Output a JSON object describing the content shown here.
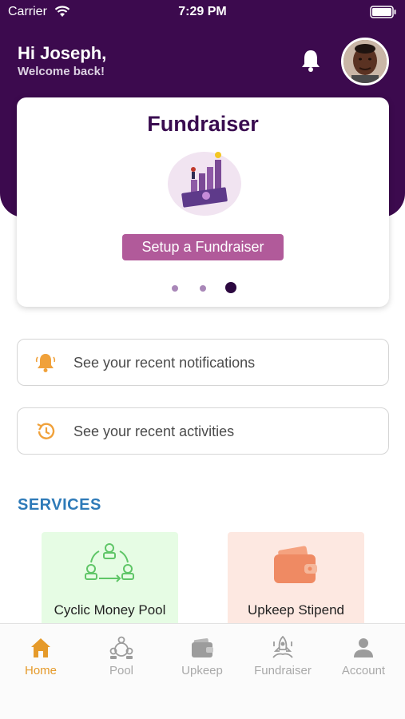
{
  "status_bar": {
    "carrier": "Carrier",
    "time": "7:29 PM"
  },
  "header": {
    "greeting": "Hi Joseph,",
    "subtitle": "Welcome back!"
  },
  "carousel": {
    "title": "Fundraiser",
    "button_label": "Setup a Fundraiser",
    "page_count": 3,
    "active_page": 3
  },
  "quick_links": [
    {
      "label": "See your recent notifications",
      "icon": "bell-icon"
    },
    {
      "label": "See your recent activities",
      "icon": "history-icon"
    }
  ],
  "services": {
    "title": "SERVICES",
    "items": [
      {
        "label": "Cyclic Money Pool",
        "icon": "cycle-people-icon"
      },
      {
        "label": "Upkeep Stipend",
        "icon": "wallet-icon"
      }
    ]
  },
  "tabbar": {
    "items": [
      {
        "label": "Home",
        "icon": "home-icon",
        "active": true
      },
      {
        "label": "Pool",
        "icon": "pool-icon",
        "active": false
      },
      {
        "label": "Upkeep",
        "icon": "wallet-icon",
        "active": false
      },
      {
        "label": "Fundraiser",
        "icon": "fundraiser-icon",
        "active": false
      },
      {
        "label": "Account",
        "icon": "person-icon",
        "active": false
      }
    ]
  },
  "colors": {
    "header": "#3c0a4e",
    "primary_button": "#b15a9a",
    "accent": "#e59a2a",
    "services_title": "#2e7ab8"
  }
}
